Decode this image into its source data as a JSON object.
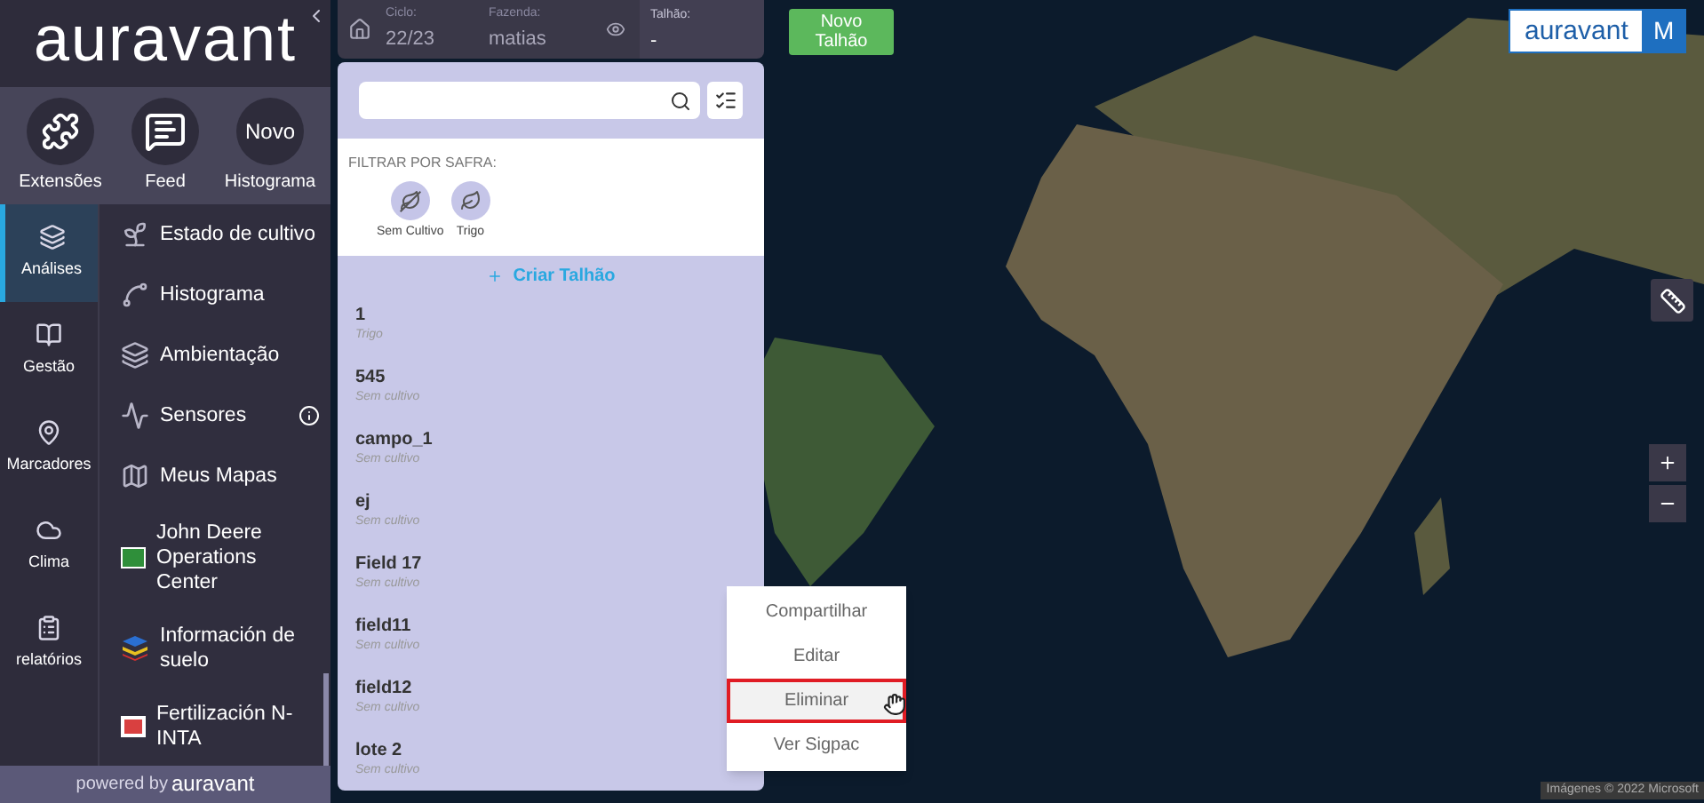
{
  "logo": {
    "text": "auravant"
  },
  "shortcuts": [
    {
      "label": "Extensões",
      "kind": "puzzle"
    },
    {
      "label": "Feed",
      "kind": "feed"
    },
    {
      "label": "Histograma",
      "kind": "new",
      "badge": "Novo"
    }
  ],
  "nav_rail": [
    {
      "label": "Análises",
      "kind": "layers",
      "selected": true
    },
    {
      "label": "Gestão",
      "kind": "book",
      "selected": false
    },
    {
      "label": "Marcadores",
      "kind": "pin",
      "selected": false
    },
    {
      "label": "Clima",
      "kind": "cloud",
      "selected": false
    },
    {
      "label": "relatórios",
      "kind": "clipboard",
      "selected": false
    }
  ],
  "submenu": [
    {
      "label": "Estado de cultivo",
      "kind": "plant",
      "info": false
    },
    {
      "label": "Histograma",
      "kind": "curve",
      "info": false
    },
    {
      "label": "Ambientação",
      "kind": "layers",
      "info": false
    },
    {
      "label": "Sensores",
      "kind": "pulse",
      "info": true
    },
    {
      "label": "Meus Mapas",
      "kind": "map",
      "info": false
    },
    {
      "label": "John Deere Operations Center",
      "kind": "tractor",
      "info": false
    },
    {
      "label": "Información de suelo",
      "kind": "soil",
      "info": false
    },
    {
      "label": "Fertilización N-INTA",
      "kind": "inta",
      "info": false
    }
  ],
  "footer": {
    "prefix": "powered by",
    "brand": "auravant"
  },
  "topbar": {
    "ciclo_label": "Ciclo:",
    "ciclo": "22/23",
    "fazenda_label": "Fazenda:",
    "fazenda": "matias",
    "talhao_label": "Talhão:",
    "talhao": "-"
  },
  "new_field_button": "Novo Talhão",
  "filter": {
    "title": "FILTRAR POR SAFRA:",
    "crops": [
      {
        "label": "Sem Cultivo",
        "kind": "none"
      },
      {
        "label": "Trigo",
        "kind": "crop"
      }
    ]
  },
  "create_link": "Criar Talhão",
  "fields": [
    {
      "name": "1",
      "crop": "Trigo"
    },
    {
      "name": "545",
      "crop": "Sem cultivo"
    },
    {
      "name": "campo_1",
      "crop": "Sem cultivo"
    },
    {
      "name": "ej",
      "crop": "Sem cultivo"
    },
    {
      "name": "Field 17",
      "crop": "Sem cultivo"
    },
    {
      "name": "field11",
      "crop": "Sem cultivo"
    },
    {
      "name": "field12",
      "crop": "Sem cultivo"
    },
    {
      "name": "lote 2",
      "crop": "Sem cultivo"
    }
  ],
  "context_menu": [
    {
      "label": "Compartilhar",
      "selected": false
    },
    {
      "label": "Editar",
      "selected": false
    },
    {
      "label": "Eliminar",
      "selected": true
    },
    {
      "label": "Ver Sigpac",
      "selected": false
    }
  ],
  "brand_badge": {
    "text": "auravant",
    "initial": "M"
  },
  "attribution": "Imágenes © 2022 Microsoft"
}
